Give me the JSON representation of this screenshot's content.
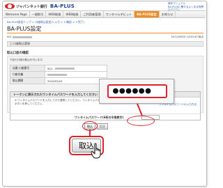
{
  "header": {
    "logo_text": "ジャパンネット銀行",
    "brand": "BA-PLUS",
    "links": [
      "操作マニュアル",
      "BA-PLUSに関するよくある質問",
      "ログアウト"
    ]
  },
  "nav": {
    "items": [
      "Welcome Page",
      "一般取引",
      "WEB総振",
      "WEB給振",
      "ご利用者管理",
      "ワンタイムデビット",
      "BA-PLUS設定",
      "お知らせ"
    ],
    "active_index": 6
  },
  "breadcrumb": "BA-PLUS設定トップ > 口座取込設定(1.入力 > 2.確認 > 3.完了)",
  "page_title": "BA-PLUS設定",
  "account": {
    "prefix": "001",
    "timestamp": "2012/06/29 14:40:45 時点"
  },
  "section_label": "口座取込登録",
  "subheading": "取込口座の確認",
  "instruction": "下記の口座の取込を行います。",
  "detail_rows": [
    {
      "label": "店番-口座番号",
      "value": "001 -"
    },
    {
      "label": "口座名義",
      "value": ""
    },
    {
      "label": "取込期間",
      "value": "2012/01/01"
    }
  ],
  "token": {
    "heading": "トークンに表示されたワンタイムパスワードを入力してください",
    "text": "※ ワンタイムパスワードを入力してから登録してください。ワンタイムパスワード入力後は、時間をおかずに「取込」ボタンを押してください。",
    "link": "ワンタイムパスワードの入力方法",
    "password_label": "ワンタイムパスワード(6桁の半角数字)"
  },
  "buttons": {
    "submit": "取込",
    "clear": "訂正"
  },
  "callout": {
    "masked_password": "●●●●●●"
  },
  "colors": {
    "brand_blue": "#1a3f8c",
    "accent_orange": "#f28c1e",
    "annotation_red": "#e0202a"
  }
}
